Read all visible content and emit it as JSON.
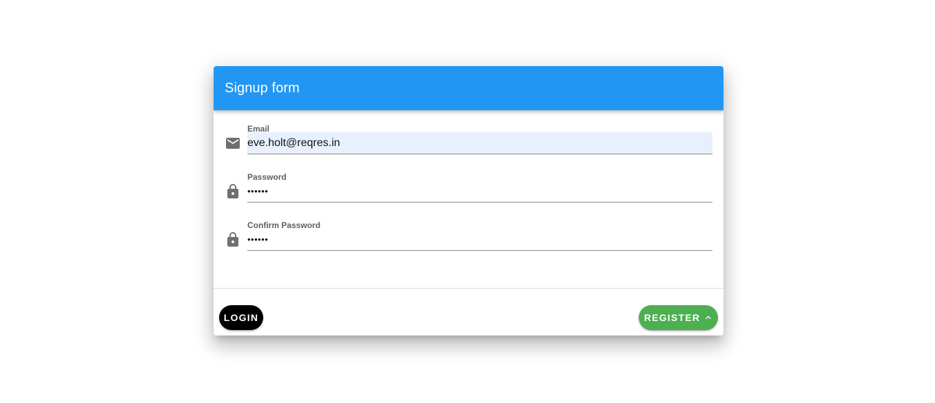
{
  "form": {
    "title": "Signup form",
    "fields": [
      {
        "label": "Email",
        "value": "eve.holt@reqres.in",
        "icon": "email-icon"
      },
      {
        "label": "Password",
        "value": "••••••",
        "icon": "lock-icon"
      },
      {
        "label": "Confirm Password",
        "value": "••••••",
        "icon": "lock-icon"
      }
    ],
    "login_label": "LOGIN",
    "register_label": "REGISTER",
    "register_icon": "chevron-up-icon"
  },
  "colors": {
    "toolbar": "#2196f3",
    "login_button": "#000000",
    "register_button": "#4caf50",
    "autofill_background": "#e8f0fe"
  }
}
